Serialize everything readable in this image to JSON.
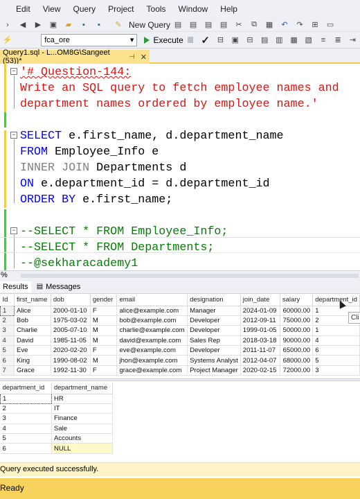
{
  "menu": {
    "items": [
      "Edit",
      "View",
      "Query",
      "Project",
      "Tools",
      "Window",
      "Help"
    ]
  },
  "toolbar": {
    "new_query_label": "New Query",
    "database_value": "fca_ore",
    "execute_label": "Execute"
  },
  "tab": {
    "title": "Query1.sql - L...OM8G\\Sangeet (53))*"
  },
  "editor": {
    "comment_line1": "'# Question-144:",
    "comment_line2": "Write an SQL query to fetch employee names and",
    "comment_line3": "department names ordered by employee name.'",
    "sql_select": "SELECT",
    "sql_select_rest": " e.first_name, d.department_name",
    "sql_from": "FROM",
    "sql_from_rest": " Employee_Info e",
    "sql_inner_join": "INNER JOIN",
    "sql_join_rest": " Departments d",
    "sql_on": "ON",
    "sql_on_rest": " e.department_id = d.department_id",
    "sql_order_by": "ORDER BY",
    "sql_order_rest": " e.first_name;",
    "commented_1": "--SELECT * FROM Employee_Info;",
    "commented_2": "--SELECT * FROM Departments;",
    "commented_3": "--@sekharacademy1"
  },
  "zoom": "%",
  "results_tabs": {
    "results": "Results",
    "messages": "Messages"
  },
  "grid1": {
    "columns": [
      "Id",
      "first_name",
      "dob",
      "gender",
      "email",
      "designation",
      "join_date",
      "salary",
      "department_id"
    ],
    "rows": [
      [
        "1",
        "Alice",
        "2000-01-10",
        "F",
        "alice@example.com",
        "Manager",
        "2024-01-09",
        "60000.00",
        "1"
      ],
      [
        "2",
        "Bob",
        "1975-03-02",
        "M",
        "bob@example.com",
        "Developer",
        "2012-09-11",
        "75000.00",
        "2"
      ],
      [
        "3",
        "Charlie",
        "2005-07-10",
        "M",
        "charlie@example.com",
        "Developer",
        "1999-01-05",
        "50000.00",
        "1"
      ],
      [
        "4",
        "David",
        "1985-11-05",
        "M",
        "david@example.com",
        "Sales Rep",
        "2018-03-18",
        "90000.00",
        "4"
      ],
      [
        "5",
        "Eve",
        "2020-02-20",
        "F",
        "eve@example.com",
        "Developer",
        "2011-11-07",
        "65000.00",
        "6"
      ],
      [
        "6",
        "King",
        "1990-08-02",
        "M",
        "jhon@example.com",
        "Systems Analyst",
        "2012-04-07",
        "68000.00",
        "5"
      ],
      [
        "7",
        "Grace",
        "1992-11-30",
        "F",
        "grace@example.com",
        "Project Manager",
        "2020-02-15",
        "72000.00",
        "3"
      ]
    ]
  },
  "tooltip_text": "Cli",
  "grid2": {
    "columns": [
      "department_id",
      "department_name"
    ],
    "rows": [
      [
        "1",
        "HR"
      ],
      [
        "2",
        "IT"
      ],
      [
        "3",
        "Finance"
      ],
      [
        "4",
        "Sale"
      ],
      [
        "5",
        "Accounts"
      ],
      [
        "6",
        "NULL"
      ]
    ]
  },
  "query_status": "Query executed successfully.",
  "status_bar": "Ready",
  "colors": {
    "status_yellow": "#f7d25d",
    "keyword_blue": "#0000ff",
    "string_red": "#e0120f",
    "comment_green": "#008000"
  }
}
